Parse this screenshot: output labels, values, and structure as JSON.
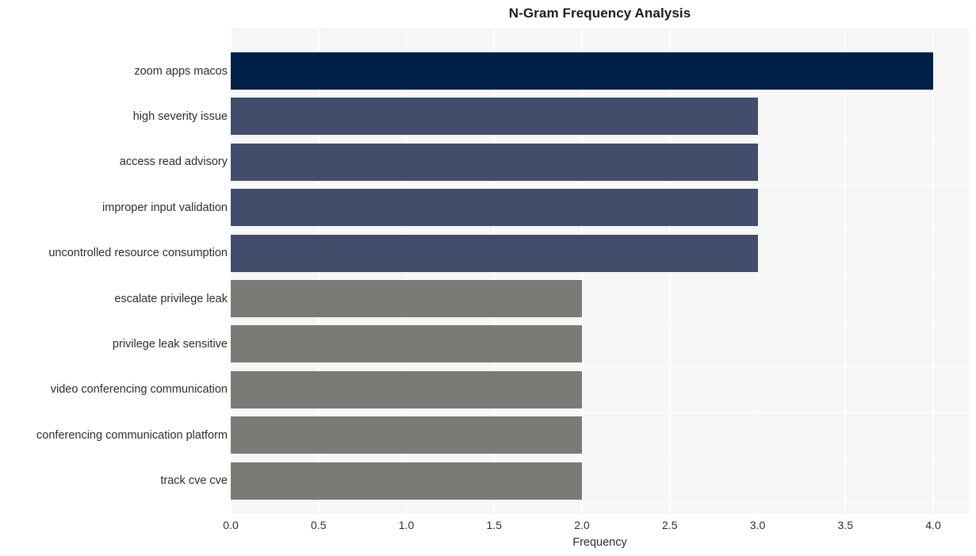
{
  "chart_data": {
    "type": "bar",
    "orientation": "horizontal",
    "title": "N-Gram Frequency Analysis",
    "xlabel": "Frequency",
    "ylabel": "",
    "categories": [
      "zoom apps macos",
      "high severity issue",
      "access read advisory",
      "improper input validation",
      "uncontrolled resource consumption",
      "escalate privilege leak",
      "privilege leak sensitive",
      "video conferencing communication",
      "conferencing communication platform",
      "track cve cve"
    ],
    "values": [
      4,
      3,
      3,
      3,
      3,
      2,
      2,
      2,
      2,
      2
    ],
    "bar_colors": [
      "#002147",
      "#424c6b",
      "#424c6b",
      "#424c6b",
      "#424c6b",
      "#7b7a77",
      "#7b7a77",
      "#7b7a77",
      "#7b7a77",
      "#7b7a77"
    ],
    "xlim": [
      0.0,
      4.0
    ],
    "xticks": [
      "0.0",
      "0.5",
      "1.0",
      "1.5",
      "2.0",
      "2.5",
      "3.0",
      "3.5",
      "4.0"
    ],
    "xtick_values": [
      0.0,
      0.5,
      1.0,
      1.5,
      2.0,
      2.5,
      3.0,
      3.5,
      4.0
    ],
    "grid": true,
    "legend": null,
    "style": {
      "figure_background": "#ffffff",
      "plot_background": "#f6f6f7",
      "gridline_color": "#ffffff",
      "text_color": "#2c2c2c",
      "title_color": "#1a1a1a"
    }
  }
}
